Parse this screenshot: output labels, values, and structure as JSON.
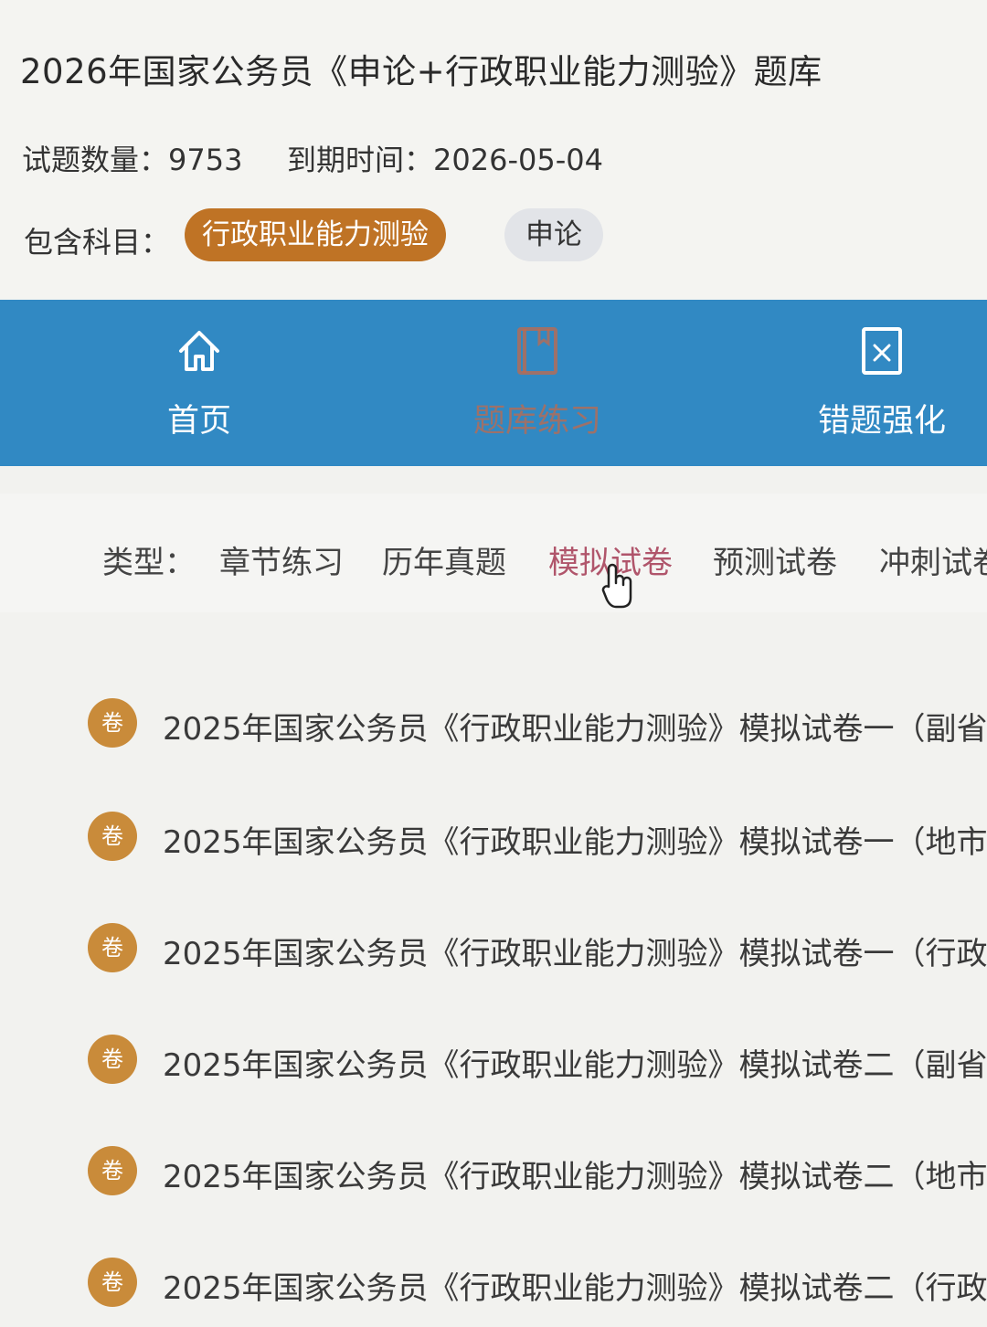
{
  "header": {
    "title": "2026年国家公务员《申论+行政职业能力测验》题库",
    "question_count": "试题数量：9753",
    "expire": "到期时间：2026-05-04",
    "subjects_label": "包含科目：",
    "subjects": [
      {
        "label": "行政职业能力测验",
        "active": true
      },
      {
        "label": "申论",
        "active": false
      }
    ]
  },
  "nav": {
    "items": [
      {
        "label": "首页",
        "icon": "home-icon"
      },
      {
        "label": "题库练习",
        "icon": "book-icon"
      },
      {
        "label": "错题强化",
        "icon": "wrong-answer-icon"
      }
    ]
  },
  "filter": {
    "label": "类型：",
    "options": [
      "章节练习",
      "历年真题",
      "模拟试卷",
      "预测试卷",
      "冲刺试卷"
    ],
    "selected": "模拟试卷"
  },
  "list": {
    "badge": "卷",
    "items": [
      "2025年国家公务员《行政职业能力测验》模拟试卷一（副省",
      "2025年国家公务员《行政职业能力测验》模拟试卷一（地市",
      "2025年国家公务员《行政职业能力测验》模拟试卷一（行政",
      "2025年国家公务员《行政职业能力测验》模拟试卷二（副省",
      "2025年国家公务员《行政职业能力测验》模拟试卷二（地市",
      "2025年国家公务员《行政职业能力测验》模拟试卷二（行政"
    ]
  },
  "colors": {
    "nav_bg": "#3189c3",
    "active_pill": "#bf7325",
    "badge": "#c98b3a",
    "active_type": "#b0556b"
  }
}
